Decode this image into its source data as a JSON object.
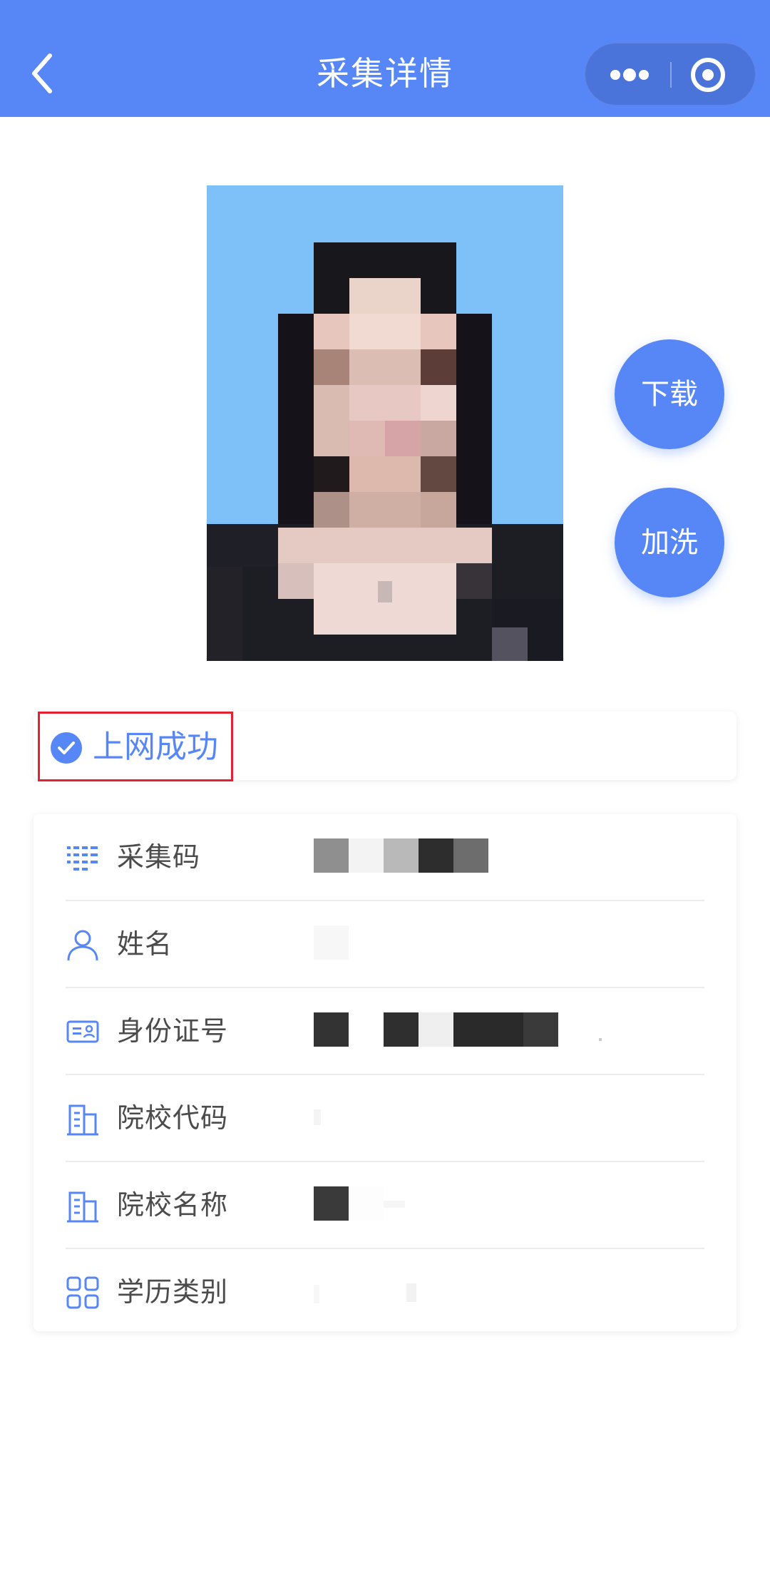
{
  "header": {
    "title": "采集详情",
    "back_icon": "chevron-left-icon",
    "more_icon": "ellipsis-icon",
    "close_icon": "target-circle-icon",
    "bg_color": "#5787f7"
  },
  "photo": {
    "background_color": "#7ec1f9"
  },
  "actions": {
    "download_label": "下载",
    "reprint_label": "加洗"
  },
  "status": {
    "icon": "check-circle-icon",
    "text": "上网成功",
    "highlight_color": "#e32131"
  },
  "info": {
    "rows": [
      {
        "icon": "list-code-icon",
        "label": "采集码"
      },
      {
        "icon": "person-icon",
        "label": "姓名"
      },
      {
        "icon": "id-card-icon",
        "label": "身份证号"
      },
      {
        "icon": "building-icon",
        "label": "院校代码"
      },
      {
        "icon": "building-icon",
        "label": "院校名称"
      },
      {
        "icon": "grid-icon",
        "label": "学历类别"
      }
    ]
  },
  "colors": {
    "accent": "#5787f7",
    "label": "#4b4b4b"
  }
}
